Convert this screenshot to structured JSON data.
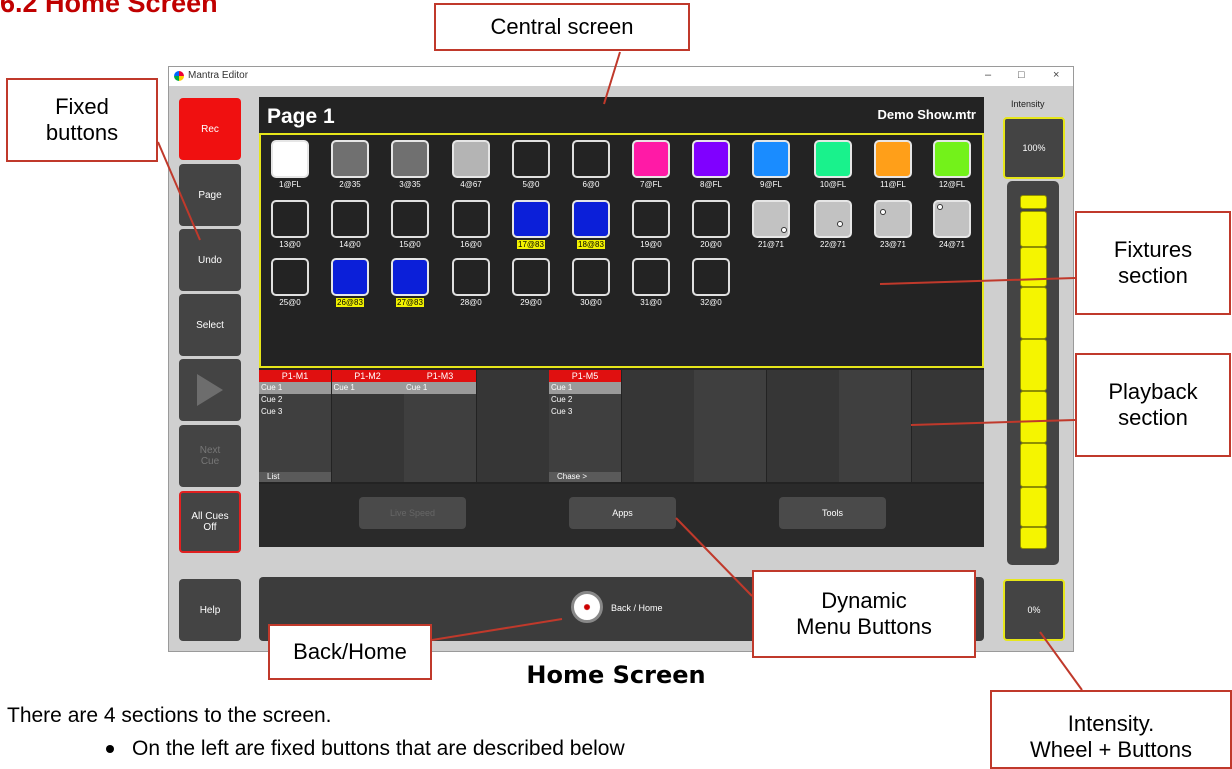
{
  "doc": {
    "heading": "6.2   Home Screen",
    "caption": "Home Screen",
    "intro": "There are 4 sections to the screen.",
    "bullets": [
      "On the left are fixed buttons that are described below"
    ]
  },
  "window": {
    "title": "Mantra Editor",
    "controls": [
      "–",
      "□",
      "×"
    ]
  },
  "fixed_buttons": [
    "Rec",
    "Page",
    "Undo",
    "Select",
    "",
    "Next\nCue",
    "All Cues\nOff",
    "Help"
  ],
  "central": {
    "page_title": "Page 1",
    "show_name": "Demo Show.mtr"
  },
  "fixtures": [
    {
      "label": "1@FL",
      "color": "#ffffff",
      "hl": false
    },
    {
      "label": "2@35",
      "color": "#707070",
      "hl": false
    },
    {
      "label": "3@35",
      "color": "#707070",
      "hl": false
    },
    {
      "label": "4@67",
      "color": "#b4b4b4",
      "hl": false
    },
    {
      "label": "5@0",
      "color": "#232323",
      "hl": false
    },
    {
      "label": "6@0",
      "color": "#232323",
      "hl": false
    },
    {
      "label": "7@FL",
      "color": "#ff1aa6",
      "hl": false
    },
    {
      "label": "8@FL",
      "color": "#8000ff",
      "hl": false
    },
    {
      "label": "9@FL",
      "color": "#1a8cff",
      "hl": false
    },
    {
      "label": "10@FL",
      "color": "#19f28c",
      "hl": false
    },
    {
      "label": "11@FL",
      "color": "#ff9f19",
      "hl": false
    },
    {
      "label": "12@FL",
      "color": "#73f21a",
      "hl": false
    },
    {
      "label": "13@0",
      "color": "#232323",
      "hl": false
    },
    {
      "label": "14@0",
      "color": "#232323",
      "hl": false
    },
    {
      "label": "15@0",
      "color": "#232323",
      "hl": false
    },
    {
      "label": "16@0",
      "color": "#232323",
      "hl": false
    },
    {
      "label": "17@83",
      "color": "#0b1fd9",
      "hl": true
    },
    {
      "label": "18@83",
      "color": "#0b1fd9",
      "hl": true
    },
    {
      "label": "19@0",
      "color": "#232323",
      "hl": false
    },
    {
      "label": "20@0",
      "color": "#232323",
      "hl": false
    },
    {
      "label": "21@71",
      "color": "#c2c2c2",
      "hl": false
    },
    {
      "label": "22@71",
      "color": "#c2c2c2",
      "hl": false
    },
    {
      "label": "23@71",
      "color": "#c2c2c2",
      "hl": false
    },
    {
      "label": "24@71",
      "color": "#c2c2c2",
      "hl": false
    },
    {
      "label": "25@0",
      "color": "#232323",
      "hl": false
    },
    {
      "label": "26@83",
      "color": "#0b1fd9",
      "hl": true
    },
    {
      "label": "27@83",
      "color": "#0b1fd9",
      "hl": true
    },
    {
      "label": "28@0",
      "color": "#232323",
      "hl": false
    },
    {
      "label": "29@0",
      "color": "#232323",
      "hl": false
    },
    {
      "label": "30@0",
      "color": "#232323",
      "hl": false
    },
    {
      "label": "31@0",
      "color": "#232323",
      "hl": false
    },
    {
      "label": "32@0",
      "color": "#232323",
      "hl": false
    }
  ],
  "playbacks": [
    {
      "header": "P1-M1",
      "cues": [
        "Cue 1",
        "Cue 2",
        "Cue 3"
      ],
      "footer": "List"
    },
    {
      "header": "P1-M2",
      "cues": [
        "Cue 1"
      ],
      "footer": ""
    },
    {
      "header": "P1-M3",
      "cues": [
        "Cue 1"
      ],
      "footer": ""
    },
    {
      "header": "",
      "cues": [],
      "footer": ""
    },
    {
      "header": "P1-M5",
      "cues": [
        "Cue 1",
        "Cue 2",
        "Cue 3"
      ],
      "footer": "Chase >"
    }
  ],
  "dynamic_menu": [
    "Live Speed",
    "Apps",
    "Tools"
  ],
  "back_home": {
    "label": "Back / Home"
  },
  "intensity": {
    "label": "Intensity",
    "top_value": "100%",
    "bottom_value": "0%"
  },
  "callouts": {
    "central_screen": "Central screen",
    "fixed_buttons": "Fixed\nbuttons",
    "fixtures_section": "Fixtures\nsection",
    "playback_section": "Playback\nsection",
    "dynamic_menu": "Dynamic\nMenu Buttons",
    "back_home": "Back/Home",
    "intensity": "Intensity.\nWheel + Buttons"
  }
}
